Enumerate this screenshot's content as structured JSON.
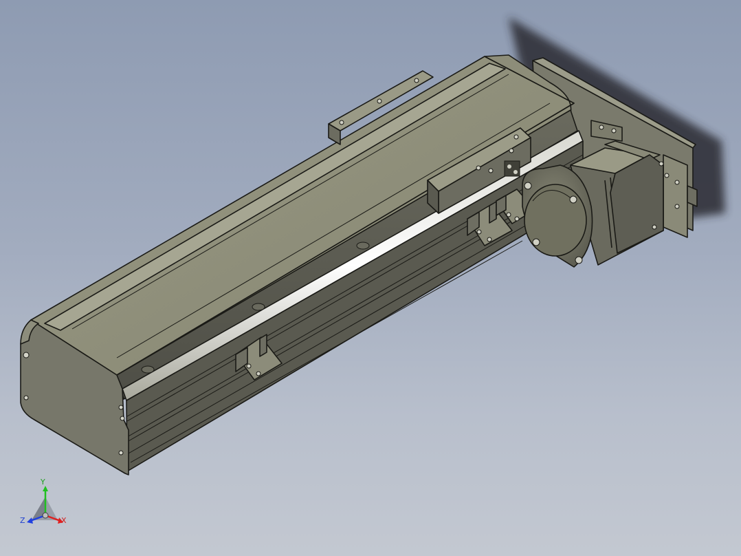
{
  "colors": {
    "background_top": "#8e9bb2",
    "background_bottom": "#c3c8d1",
    "part_light": "#8f8f7b",
    "part_mid": "#76766a",
    "part_dark": "#55554b",
    "axis_x": "#e02020",
    "axis_y": "#20c020",
    "axis_z": "#2040e0"
  },
  "triad": {
    "x_label": "X",
    "y_label": "Y",
    "z_label": "Z"
  },
  "icons": {
    "triad": "coordinate-triad-icon"
  }
}
